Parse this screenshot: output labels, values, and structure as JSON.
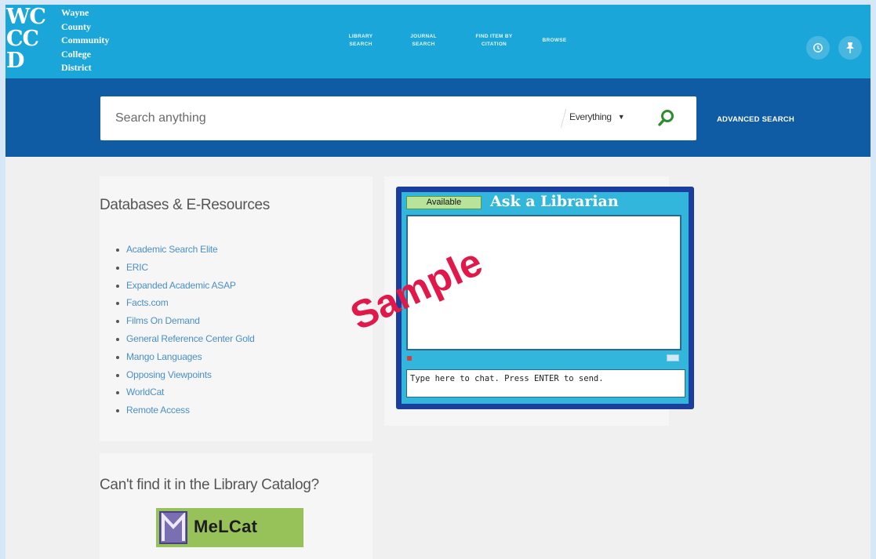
{
  "header": {
    "logo_mark": [
      "WC",
      "CC",
      "D"
    ],
    "logo_text": [
      "Wayne",
      "County",
      "Community",
      "College",
      "District"
    ],
    "nav": [
      {
        "line1": "LIBRARY",
        "line2": "SEARCH"
      },
      {
        "line1": "JOURNAL",
        "line2": "SEARCH"
      },
      {
        "line1": "FIND ITEM BY",
        "line2": "CITATION"
      },
      {
        "line1": "BROWSE",
        "line2": ""
      }
    ],
    "icons": [
      "history-icon",
      "pin-icon"
    ]
  },
  "search": {
    "placeholder": "Search anything",
    "scope": "Everything",
    "advanced_label": "ADVANCED SEARCH",
    "accent": "#2e8b2e"
  },
  "databases": {
    "title": "Databases & E-Resources",
    "items": [
      "Academic Search Elite",
      "ERIC",
      "Expanded Academic ASAP",
      "Facts.com",
      "Films On Demand",
      "General Reference Center Gold",
      "Mango Languages",
      "Opposing Viewpoints",
      "WorldCat",
      "Remote Access"
    ]
  },
  "melcat": {
    "title": "Can't find it in the Library Catalog?",
    "logo_text": "MeLCat"
  },
  "chat": {
    "status": "Available",
    "title": "Ask a Librarian",
    "placeholder": "Type here to chat. Press ENTER to send."
  },
  "watermark": "Sample",
  "colors": {
    "topbar": "#1aa6d8",
    "searchband": "#0f5ba4",
    "link": "#4a8fc9",
    "watermark": "#e0194a"
  }
}
